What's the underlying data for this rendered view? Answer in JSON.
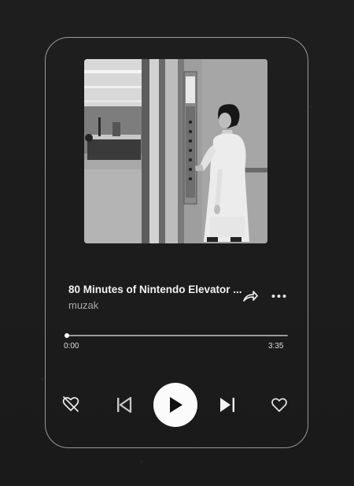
{
  "player": {
    "track_title": "80 Minutes of Nintendo Elevator ...",
    "artist": "muzak",
    "time_current": "0:00",
    "time_total": "3:35",
    "progress_fraction": 0.01
  },
  "icons": {
    "share": "share-icon",
    "more": "more-options-icon",
    "dislike": "heart-slash-icon",
    "previous": "skip-previous-icon",
    "play": "play-icon",
    "next": "skip-next-icon",
    "like": "heart-icon"
  },
  "colors": {
    "background": "#1c1c1c",
    "card_border": "#8c8c8c",
    "title": "#f2f2f2",
    "artist": "#a9a9a9",
    "play_button": "#fbfbfb"
  }
}
